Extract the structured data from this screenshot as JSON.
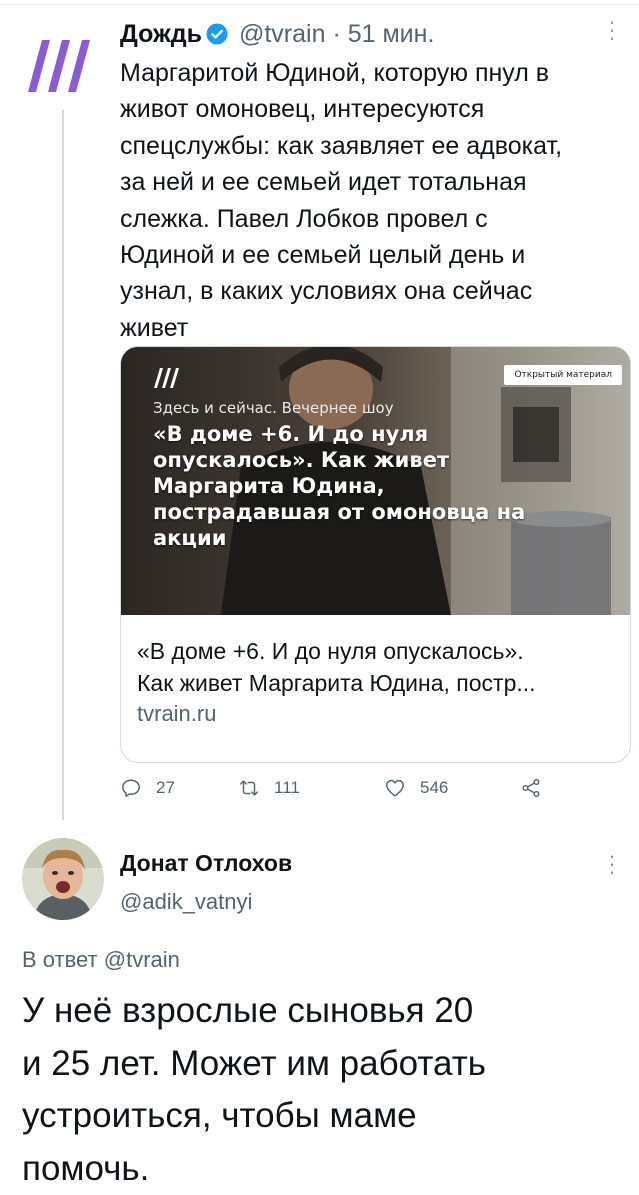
{
  "tweet": {
    "author_name": "Дождь",
    "handle": "@tvrain",
    "separator": "·",
    "time": "51 мин.",
    "more_icon": "more-vertical-icon",
    "text": "Маргаритой Юдиной, которую пнул в\nживот омоновец, интересуются\nспецслужбы: как заявляет ее адвокат,\nза ней и ее семьей идет тотальная\nслежка. Павел Лобков провел с\nЮдиной и ее семьей целый день и\nузнал, в каких условиях она сейчас\nживет",
    "card": {
      "media_show": "Здесь и сейчас. Вечернее шоу",
      "media_headline": "«В доме +6. И до нуля\nопускалось». Как живет\nМаргарита Юдина,\nпострадавшая от омоновца на\nакции",
      "media_badge": "Открытый материал",
      "title": "«В доме +6. И до нуля опускалось».\nКак живет Маргарита Юдина, постр...",
      "domain": "tvrain.ru"
    },
    "actions": {
      "replies": "27",
      "retweets": "111",
      "likes": "546"
    }
  },
  "reply": {
    "author_name": "Донат Отлохов",
    "handle": "@adik_vatnyi",
    "reply_label": "В ответ",
    "reply_to": "@tvrain",
    "text": "У неё взрослые сыновья 20\nи 25 лет. Может им работать\nустроиться, чтобы маме\nпомочь."
  },
  "colors": {
    "brand_logo": "#8a5bd6",
    "verified": "#1d9bf0",
    "secondary_text": "#536471",
    "border": "#cfd9de"
  }
}
